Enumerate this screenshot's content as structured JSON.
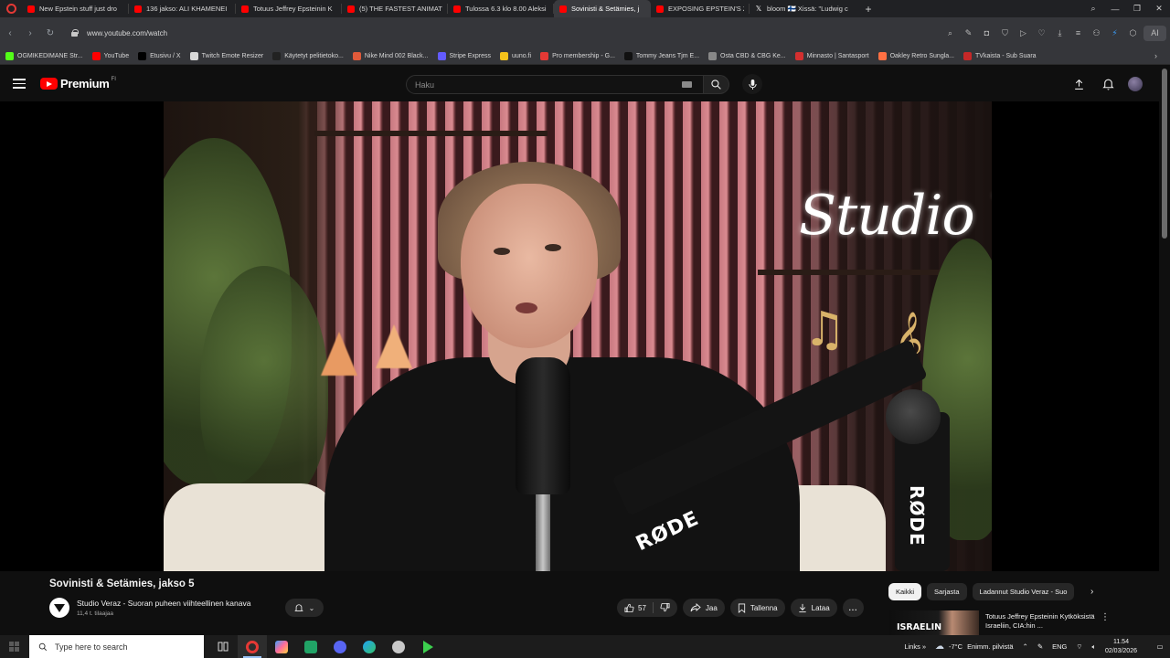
{
  "browser": {
    "tabs": [
      {
        "title": "New Epstein stuff just dro",
        "favicon": "yt",
        "active": false
      },
      {
        "title": "136 jakso: ALI KHAMENEI",
        "favicon": "yt",
        "active": false
      },
      {
        "title": "Totuus Jeffrey Epsteinin K",
        "favicon": "yt",
        "active": false
      },
      {
        "title": "(5) THE FASTEST ANIMATI",
        "favicon": "yt",
        "active": false
      },
      {
        "title": "Tulossa 6.3 klo 8.00 Aleksi",
        "favicon": "yt",
        "active": false
      },
      {
        "title": "Sovinisti & Setämies, j",
        "favicon": "yt",
        "active": true
      },
      {
        "title": "EXPOSING EPSTEIN'S ZOR",
        "favicon": "yt",
        "active": false
      },
      {
        "title": "bloom 🇫🇮 Xissä: \"Ludwig c",
        "favicon": "x",
        "active": false
      }
    ],
    "url": "www.youtube.com/watch",
    "ext_ai_label": "AI",
    "bookmarks": [
      {
        "label": "OGMIKEDIMANE Str...",
        "color": "#53fc18"
      },
      {
        "label": "YouTube",
        "color": "#ff0000"
      },
      {
        "label": "Etusivu / X",
        "color": "#000000"
      },
      {
        "label": "Twitch Emote Resizer",
        "color": "#d8d8d8"
      },
      {
        "label": "Käytetyt pelitietoko...",
        "color": "#222222"
      },
      {
        "label": "Nike Mind 002 Black...",
        "color": "#e05a3a"
      },
      {
        "label": "Stripe Express",
        "color": "#635bff"
      },
      {
        "label": "uuno.fi",
        "color": "#f4c21b"
      },
      {
        "label": "Pro membership - G...",
        "color": "#e53935"
      },
      {
        "label": "Tommy Jeans Tjm E...",
        "color": "#111111"
      },
      {
        "label": "Osta CBD & CBG Ke...",
        "color": "#888888"
      },
      {
        "label": "Minnasto | Santasport",
        "color": "#d32f2f"
      },
      {
        "label": "Oakley Retro Sungla...",
        "color": "#ff7043"
      },
      {
        "label": "TVkaista - Sub Suara",
        "color": "#c62828"
      }
    ]
  },
  "youtube": {
    "logo_text": "Premium",
    "logo_sup": "FI",
    "search_placeholder": "Haku",
    "video": {
      "overlay_brand": "Studio V",
      "mic_brand": "RØDE",
      "title": "Sovinisti & Setämies, jakso 5",
      "channel_name": "Studio Veraz - Suoran puheen viihteellinen kanava",
      "subscribers": "11,4 t. tilaajaa",
      "likes": "57",
      "share_label": "Jaa",
      "save_label": "Tallenna",
      "download_label": "Lataa",
      "more_label": "..."
    },
    "chips": [
      "Kaikki",
      "Sarjasta",
      "Ladannut Studio Veraz - Suo"
    ],
    "recommendation": {
      "thumb_text": "ISRAELIN",
      "title": "Totuus Jeffrey Epsteinin Kytköksistä Israeliin, CIA:hin ..."
    }
  },
  "taskbar": {
    "search_placeholder": "Type here to search",
    "links_label": "Links",
    "temperature": "-7°C",
    "weather": "Enimm. pilvistä",
    "language": "ENG",
    "time": "11.54",
    "date": "02/03/2026"
  },
  "colors": {
    "yt_red": "#ff0000",
    "bg": "#0f0f0f",
    "chrome_bar": "#35363a",
    "tabstrip": "#202124"
  }
}
